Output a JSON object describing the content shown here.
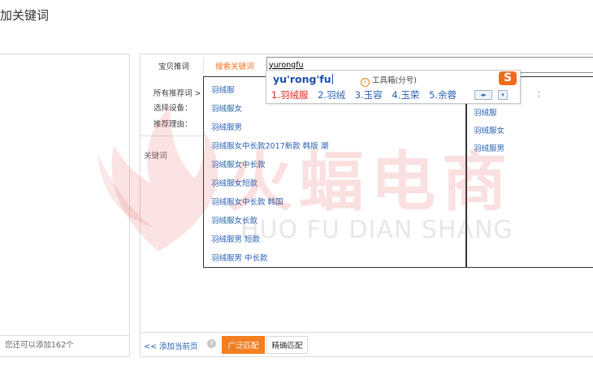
{
  "page": {
    "title": "加关键词"
  },
  "left_panel": {
    "remaining_text": "您还可以添加162个"
  },
  "tabs": [
    {
      "label": "宝贝推词"
    },
    {
      "label": "搜索关键词"
    }
  ],
  "search": {
    "value": "yurongfu"
  },
  "filters": [
    {
      "label": "所有推荐词 >"
    },
    {
      "label": "选择设备："
    },
    {
      "label": "推荐理由："
    }
  ],
  "keywords_label": "关键词",
  "suggestions": [
    "羽绒服",
    "羽绒服女",
    "羽绒服男",
    "羽绒服女中长款2017新款 韩版 潮",
    "羽绒服女中长款",
    "羽绒服女短款",
    "羽绒服女中长款 韩国",
    "羽绒服女长款",
    "羽绒服男 短款",
    "羽绒服男 中长款"
  ],
  "right_column": {
    "colon": "：",
    "items": [
      "羽绒服",
      "羽绒服女",
      "羽绒服男"
    ]
  },
  "ime": {
    "composition": "yu'rong'fu",
    "toolbox_label": "工具箱(分号)",
    "logo_letter": "S",
    "candidates": [
      "1.羽绒服",
      "2.羽绒",
      "3.玉容",
      "4.玉荣",
      "5.余蓉"
    ],
    "nav_lr": "◂▸",
    "nav_down": "▾"
  },
  "bottom_bar": {
    "add_current_page": "<< 添加当前页",
    "help_icon": "?",
    "broad_match": "广泛匹配",
    "exact_match": "精确匹配"
  },
  "watermark": {
    "chinese": "火蝠电商",
    "english": "HUO FU DIAN SHANG"
  },
  "colors": {
    "accent_orange": "#f27f22",
    "link_blue": "#2a62b5",
    "candidate_red": "#e8231c",
    "ime_logo": "#f26a1b"
  }
}
